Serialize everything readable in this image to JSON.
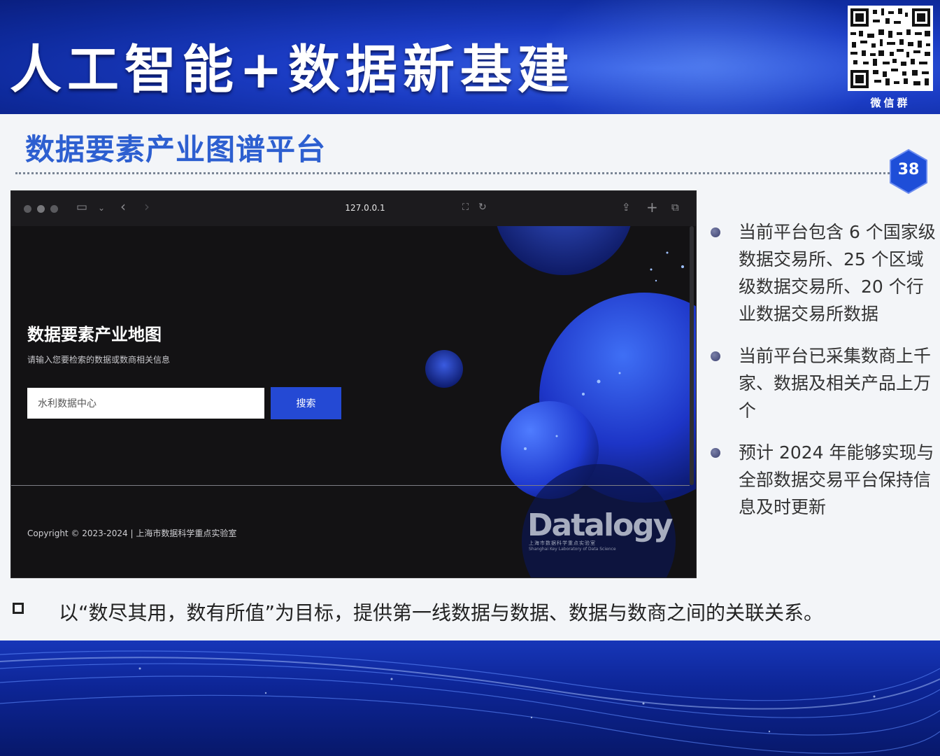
{
  "header": {
    "title": "人工智能+数据新基建",
    "qr_label": "微信群"
  },
  "slide": {
    "subtitle": "数据要素产业图谱平台",
    "page_number": "38"
  },
  "browser": {
    "url": "127.0.0.1",
    "hero_title": "数据要素产业地图",
    "hero_subtitle": "请输入您要检索的数据或数商相关信息",
    "search_value": "水利数据中心",
    "search_button": "搜索",
    "copyright": "Copyright © 2023-2024 | 上海市数据科学重点实验室",
    "logo": "Datalogy",
    "logo_sub_cn": "上海市数据科学重点实验室",
    "logo_sub_en": "Shanghai Key Laboratory of Data Science"
  },
  "bullets": [
    "当前平台包含 6 个国家级数据交易所、25 个区域级数据交易所、20 个行业数据交易所数据",
    "当前平台已采集数商上千家、数据及相关产品上万个",
    "预计 2024 年能够实现与全部数据交易平台保持信息及时更新"
  ],
  "bottom_note": "以“数尽其用，数有所值”为目标，提供第一线数据与数据、数据与数商之间的关联关系。",
  "colors": {
    "banner_blue": "#1b3cc4",
    "subtitle_blue": "#2d5fd0",
    "search_button": "#2449d4"
  }
}
